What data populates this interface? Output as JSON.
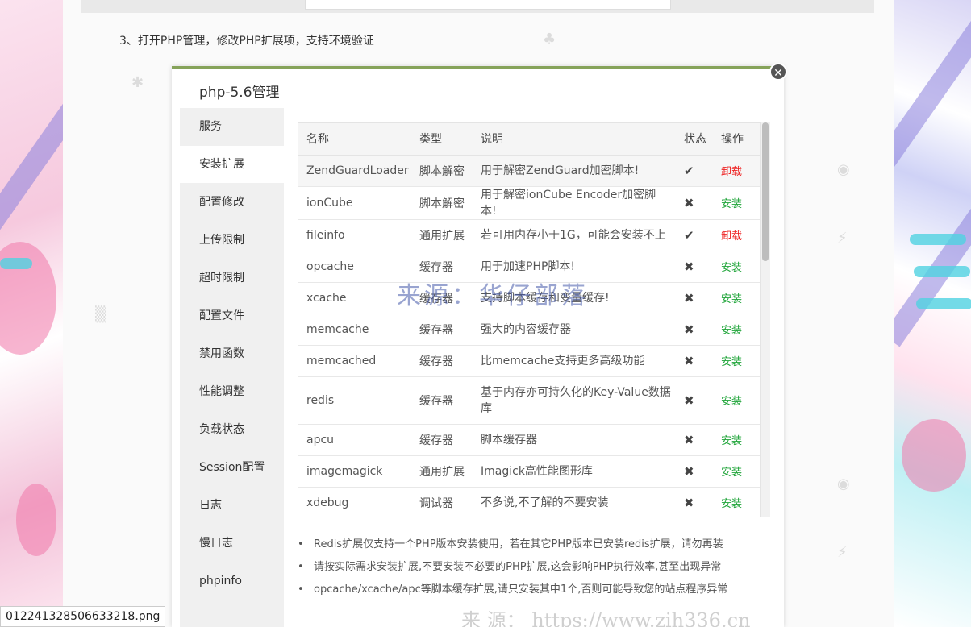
{
  "article": {
    "step_text": "3、打开PHP管理，修改PHP扩展项，支持环境验证"
  },
  "dialog": {
    "title": "php-5.6管理",
    "close_glyph": "✕",
    "menu": [
      {
        "label": "服务",
        "active": false
      },
      {
        "label": "安装扩展",
        "active": true
      },
      {
        "label": "配置修改",
        "active": false
      },
      {
        "label": "上传限制",
        "active": false
      },
      {
        "label": "超时限制",
        "active": false
      },
      {
        "label": "配置文件",
        "active": false
      },
      {
        "label": "禁用函数",
        "active": false
      },
      {
        "label": "性能调整",
        "active": false
      },
      {
        "label": "负载状态",
        "active": false
      },
      {
        "label": "Session配置",
        "active": false
      },
      {
        "label": "日志",
        "active": false
      },
      {
        "label": "慢日志",
        "active": false
      },
      {
        "label": "phpinfo",
        "active": false
      }
    ],
    "table": {
      "headers": {
        "name": "名称",
        "type": "类型",
        "desc": "说明",
        "status": "状态",
        "op": "操作"
      },
      "rows": [
        {
          "name": "ZendGuardLoader",
          "type": "脚本解密",
          "desc": "用于解密ZendGuard加密脚本!",
          "installed": true,
          "op": "卸载"
        },
        {
          "name": "ionCube",
          "type": "脚本解密",
          "desc": "用于解密ionCube Encoder加密脚本!",
          "installed": false,
          "op": "安装"
        },
        {
          "name": "fileinfo",
          "type": "通用扩展",
          "desc": "若可用内存小于1G，可能会安装不上",
          "installed": true,
          "op": "卸载"
        },
        {
          "name": "opcache",
          "type": "缓存器",
          "desc": "用于加速PHP脚本!",
          "installed": false,
          "op": "安装"
        },
        {
          "name": "xcache",
          "type": "缓存器",
          "desc": "支持脚本缓存和变量缓存!",
          "installed": false,
          "op": "安装"
        },
        {
          "name": "memcache",
          "type": "缓存器",
          "desc": "强大的内容缓存器",
          "installed": false,
          "op": "安装"
        },
        {
          "name": "memcached",
          "type": "缓存器",
          "desc": "比memcache支持更多高级功能",
          "installed": false,
          "op": "安装"
        },
        {
          "name": "redis",
          "type": "缓存器",
          "desc": "基于内存亦可持久化的Key-Value数据库",
          "installed": false,
          "op": "安装"
        },
        {
          "name": "apcu",
          "type": "缓存器",
          "desc": "脚本缓存器",
          "installed": false,
          "op": "安装"
        },
        {
          "name": "imagemagick",
          "type": "通用扩展",
          "desc": "Imagick高性能图形库",
          "installed": false,
          "op": "安装"
        },
        {
          "name": "xdebug",
          "type": "调试器",
          "desc": "不多说,不了解的不要安装",
          "installed": false,
          "op": "安装"
        }
      ],
      "status_icons": {
        "installed": "✔",
        "not_installed": "✖"
      },
      "colors": {
        "install": "#20a53a",
        "uninstall": "#ee2222"
      }
    },
    "notes": [
      "Redis扩展仅支持一个PHP版本安装使用，若在其它PHP版本已安装redis扩展，请勿再装",
      "请按实际需求安装扩展,不要安装不必要的PHP扩展,这会影响PHP执行效率,甚至出现异常",
      "opcache/xcache/apc等脚本缓存扩展,请只安装其中1个,否则可能导致您的站点程序异常"
    ]
  },
  "overlay": {
    "watermark": "来源：华仔部落",
    "watermark_bottom": "来 源： https://www.zih336.cn",
    "file_label": "0122413285066332​18.png"
  }
}
